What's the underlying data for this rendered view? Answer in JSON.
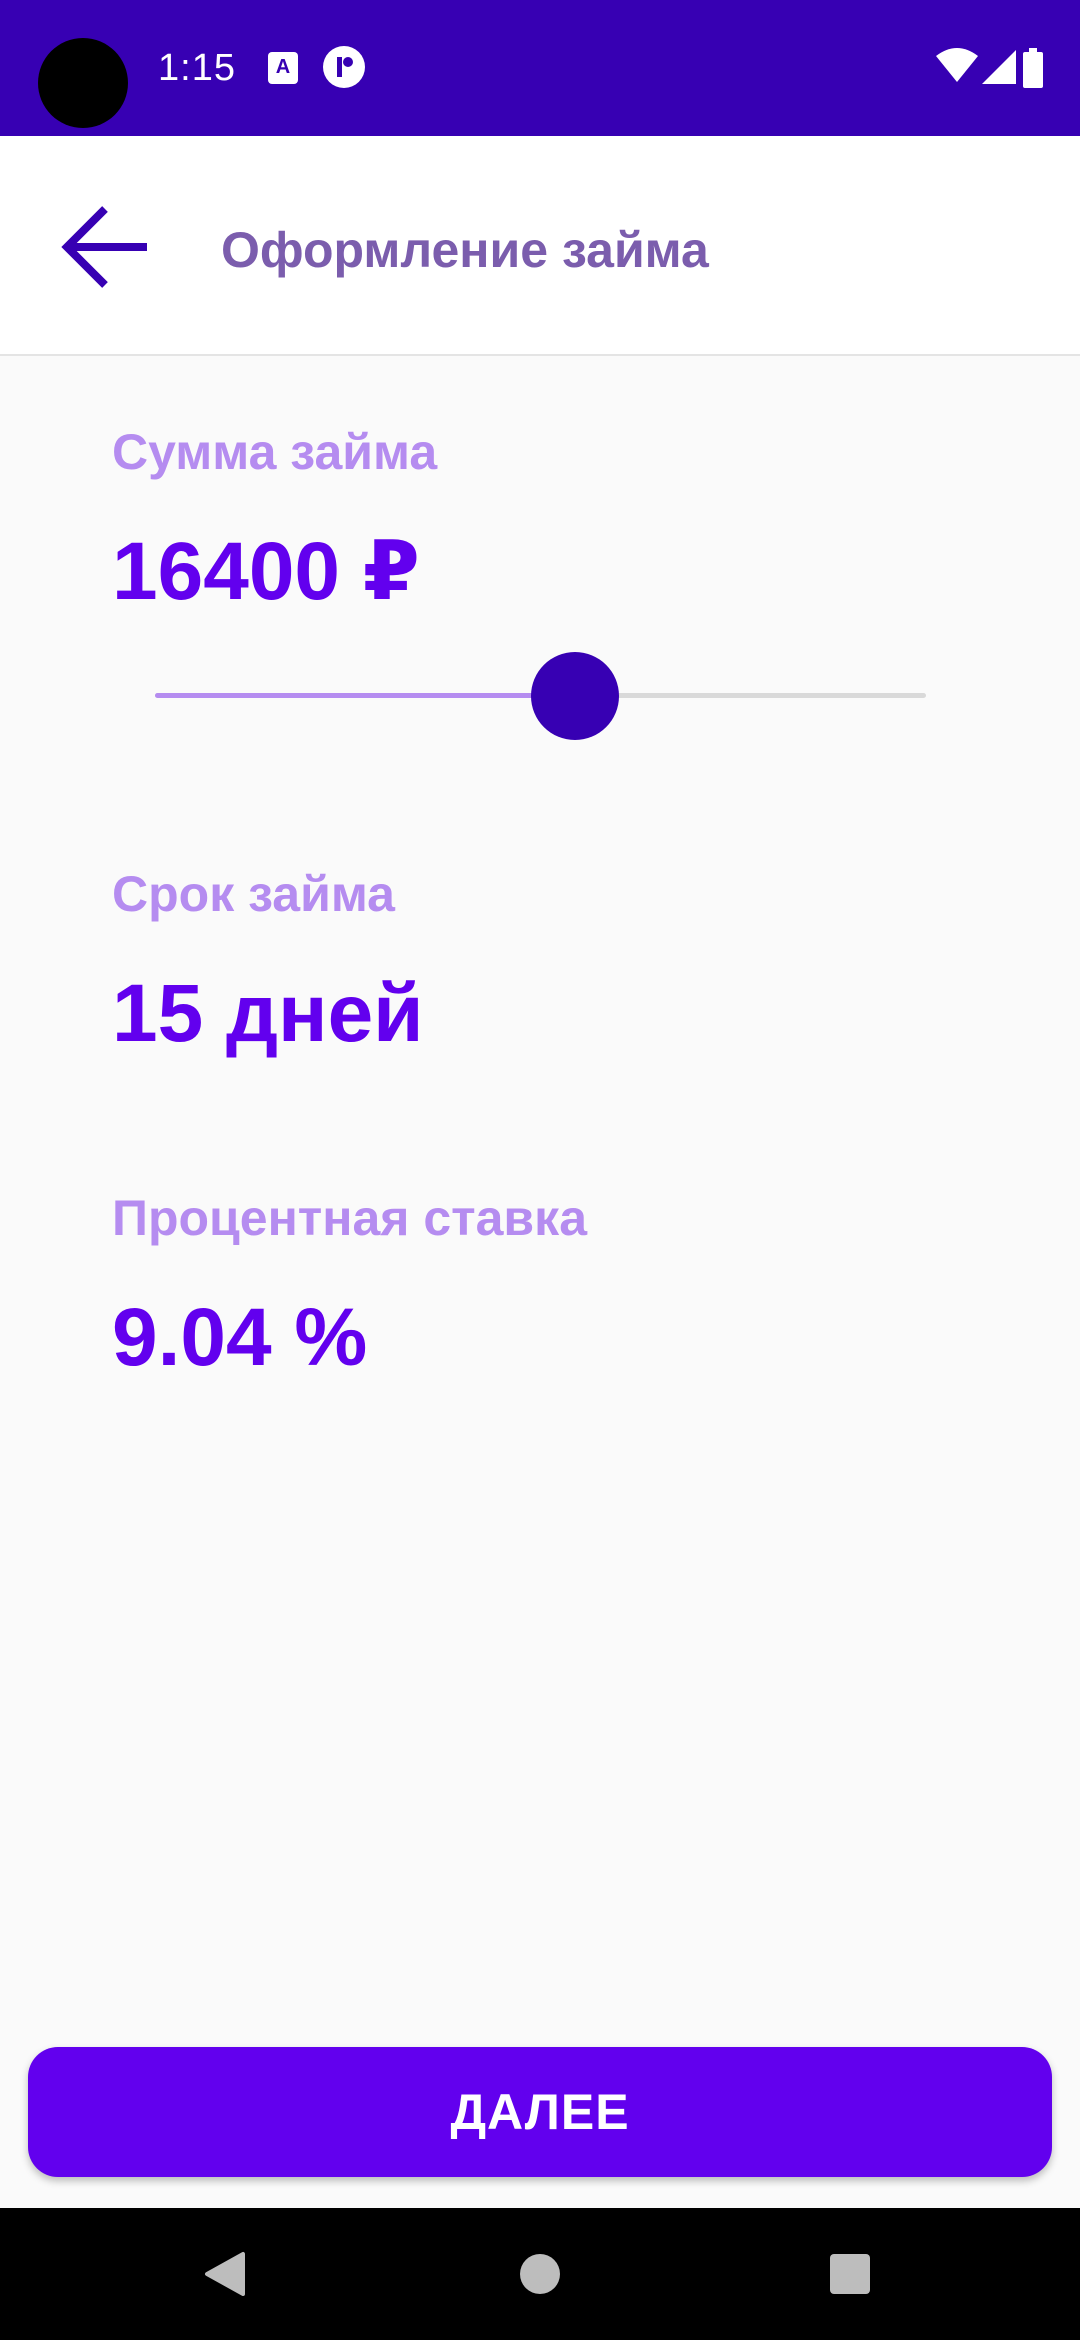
{
  "status_bar": {
    "time": "1:15",
    "notification_a": "A",
    "icons": [
      "wifi-icon",
      "signal-icon",
      "battery-icon"
    ]
  },
  "app_bar": {
    "title": "Оформление займа",
    "back_icon": "arrow-left-icon"
  },
  "loan": {
    "amount_label": "Сумма займа",
    "amount_value": "16400 ₽",
    "slider_fraction": 0.545,
    "term_label": "Срок займа",
    "term_value": "15 дней",
    "rate_label": "Процентная ставка",
    "rate_value": "9.04 %"
  },
  "actions": {
    "next_label": "ДАЛЕЕ"
  },
  "nav_bar": {
    "icons": [
      "back-triangle-icon",
      "home-circle-icon",
      "recents-square-icon"
    ]
  },
  "colors": {
    "status_bar": "#3700b3",
    "primary": "#6200ee",
    "primary_dark": "#3700b3",
    "label": "#b58cf0",
    "title": "#7b5dad",
    "background": "#fafafa"
  }
}
